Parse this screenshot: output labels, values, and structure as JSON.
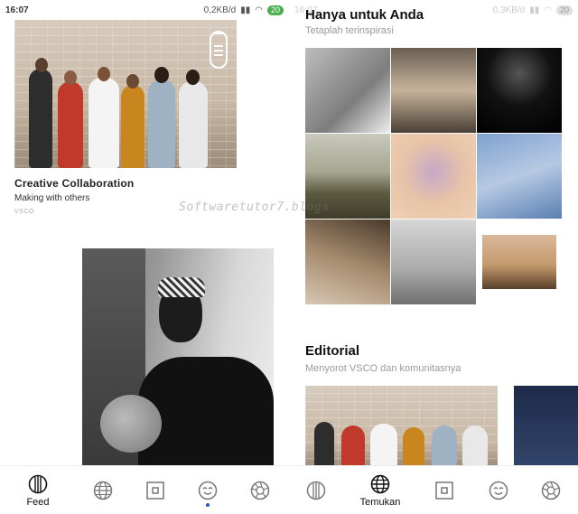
{
  "status_left": {
    "time": "16:07",
    "speed": "0,2KB/d",
    "battery": "20"
  },
  "status_right": {
    "time": "16:07",
    "speed": "0,3KB/d",
    "battery": "20"
  },
  "feed": {
    "card_title": "Creative Collaboration",
    "card_subtitle": "Making with others",
    "card_credit": "VSCO"
  },
  "watermark": "Softwaretutor7.blogs",
  "discover": {
    "section1_title": "Hanya untuk Anda",
    "section1_subtitle": "Tetaplah terinspirasi",
    "section2_title": "Editorial",
    "section2_subtitle": "Menyorot VSCO dan komunitasnya"
  },
  "tabs_left": [
    {
      "name": "feed",
      "label": "Feed",
      "icon": "feed-icon",
      "active": true
    },
    {
      "name": "discover",
      "label": "",
      "icon": "globe-icon",
      "active": false
    },
    {
      "name": "studio",
      "label": "",
      "icon": "studio-icon",
      "active": false
    },
    {
      "name": "profile",
      "label": "",
      "icon": "face-icon",
      "active": false
    },
    {
      "name": "store",
      "label": "",
      "icon": "aperture-icon",
      "active": false
    }
  ],
  "tabs_right": [
    {
      "name": "feed",
      "label": "",
      "icon": "feed-icon",
      "active": false
    },
    {
      "name": "discover",
      "label": "Temukan",
      "icon": "globe-icon",
      "active": true
    },
    {
      "name": "studio",
      "label": "",
      "icon": "studio-icon",
      "active": false
    },
    {
      "name": "profile",
      "label": "",
      "icon": "face-icon",
      "active": false
    },
    {
      "name": "store",
      "label": "",
      "icon": "aperture-icon",
      "active": false
    }
  ],
  "colors": {
    "accent_dot": "#2a52d8",
    "battery_green": "#4caf50"
  }
}
